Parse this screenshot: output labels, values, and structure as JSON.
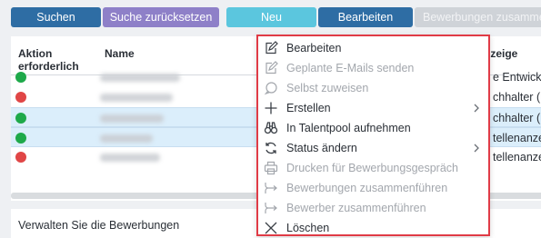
{
  "toolbar": {
    "search": "Suchen",
    "reset": "Suche zurücksetzen",
    "new": "Neu",
    "edit": "Bearbeiten",
    "merge": "Bewerbungen zusammenführen"
  },
  "table": {
    "col_action": "Aktion erforderlich",
    "col_name": "Name",
    "col_ad": "nzeige",
    "rows": [
      {
        "status": "green",
        "ad": "e Entwickler",
        "selected": false
      },
      {
        "status": "red",
        "ad": "chhalter (m",
        "selected": false
      },
      {
        "status": "green",
        "ad": "chhalter (m",
        "selected": true
      },
      {
        "status": "green",
        "ad": "tellenanzeig",
        "selected": true
      },
      {
        "status": "red",
        "ad": "tellenanzeig",
        "selected": false
      }
    ]
  },
  "footer": {
    "text": "Verwalten Sie die Bewerbungen"
  },
  "menu": {
    "items": [
      {
        "label": "Bearbeiten",
        "icon": "edit-icon",
        "enabled": true
      },
      {
        "label": "Geplante E-Mails senden",
        "icon": "edit-icon",
        "enabled": false
      },
      {
        "label": "Selbst zuweisen",
        "icon": "comment-icon",
        "enabled": false
      },
      {
        "label": "Erstellen",
        "icon": "plus-icon",
        "enabled": true,
        "submenu": true
      },
      {
        "label": "In Talentpool aufnehmen",
        "icon": "binoculars-icon",
        "enabled": true
      },
      {
        "label": "Status ändern",
        "icon": "refresh-icon",
        "enabled": true,
        "submenu": true
      },
      {
        "label": "Drucken für Bewerbungsgespräch",
        "icon": "print-icon",
        "enabled": false
      },
      {
        "label": "Bewerbungen zusammenführen",
        "icon": "merge-icon",
        "enabled": false
      },
      {
        "label": "Bewerber zusammenführen",
        "icon": "merge-icon",
        "enabled": false
      },
      {
        "label": "Löschen",
        "icon": "close-icon",
        "enabled": true
      }
    ]
  },
  "colors": {
    "primary": "#2e6da4",
    "secondary": "#8e80c8",
    "info": "#5bc6de",
    "disabled": "#cfd3d8",
    "status_green": "#1ea94a",
    "status_red": "#e04646",
    "highlight": "#e03b46"
  }
}
